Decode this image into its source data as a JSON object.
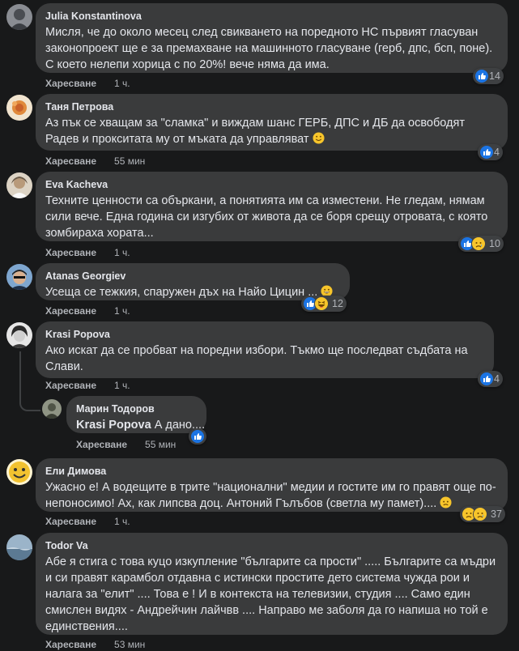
{
  "like_label": "Харесване",
  "comments": [
    {
      "author": "Julia Konstantinova",
      "text": "Мисля, че до около месец след свикването на поредното НС първият гласуван законопроект ще е за премахване на машинното гласуване (герб, дпс, бсп, поне). С което нелепи хорица с по 20%! вече няма да има.",
      "time": "1 ч.",
      "reactions": [
        "like"
      ],
      "reaction_count": "14",
      "avatar_color": "#7b7f86"
    },
    {
      "author": "Таня Петрова",
      "text": "Аз пък се хващам за \"сламка\" и виждам шанс ГЕРБ, ДПС и ДБ да освободят Радев и прокситата му от мъката да управляват",
      "emoji_end": "smile",
      "time": "55 мин",
      "reactions": [
        "like"
      ],
      "reaction_count": "4",
      "avatar_color": "#e0a35a"
    },
    {
      "author": "Eva Kacheva",
      "text": "Техните ценности са объркани, а понятията им са изместени. Не гледам, нямам сили вече. Една година си изгубих от живота да се боря срещу отровата, с която зомбираха хората...",
      "time": "1 ч.",
      "reactions": [
        "like",
        "sad"
      ],
      "reaction_count": "10",
      "avatar_color": "#c9bfae"
    },
    {
      "author": "Atanas Georgiev",
      "text": "Усеща се тежкия, спаружен дъх на Найо Цицин ...",
      "emoji_end": "grin",
      "time": "1 ч.",
      "reactions": [
        "like",
        "haha"
      ],
      "reaction_count": "12",
      "avatar_color": "#3d5f8a"
    },
    {
      "author": "Krasi Popova",
      "text": "Ако искат да се пробват на поредни избори. Тъкмо ще последват съдбата на Слави.",
      "time": "1 ч.",
      "reactions": [
        "like"
      ],
      "reaction_count": "4",
      "avatar_color": "#d8d8d8"
    },
    {
      "author": "Марин Тодоров",
      "mention": "Krasi Popova",
      "text": "А дано....",
      "time": "55 мин",
      "reactions": [
        "like"
      ],
      "reaction_count": "",
      "avatar_color": "#6a6f60"
    },
    {
      "author": "Ели Димова",
      "text": "Ужасно е! А водещите в трите \"национални\" медии и гостите им го правят още по-непоносимо! Ах, как липсва доц. Антоний Гълъбов (светла му памет)....",
      "emoji_end": "sad",
      "time": "1 ч.",
      "reactions": [
        "sad",
        "sad"
      ],
      "reaction_count": "37",
      "avatar_color": "#f2c230"
    },
    {
      "author": "Todor Va",
      "text": "Абе я стига с това куцо изкупление \"българите са прости\" ..... Българите са мъдри и си правят карамбол отдавна с истински простите дето система чужда рои и налага за \"елит\" .... Това е ! И в контекста на телевизии, студия .... Само един смислен видях - Андрейчин лайчвв .... Направо ме заболя да го напиша но той е единствения....",
      "time": "53 мин",
      "reactions": [],
      "reaction_count": "",
      "avatar_color": "#5f7b92"
    }
  ],
  "icons": {
    "like": "like-reaction-icon",
    "sad": "sad-reaction-icon",
    "haha": "haha-reaction-icon"
  }
}
